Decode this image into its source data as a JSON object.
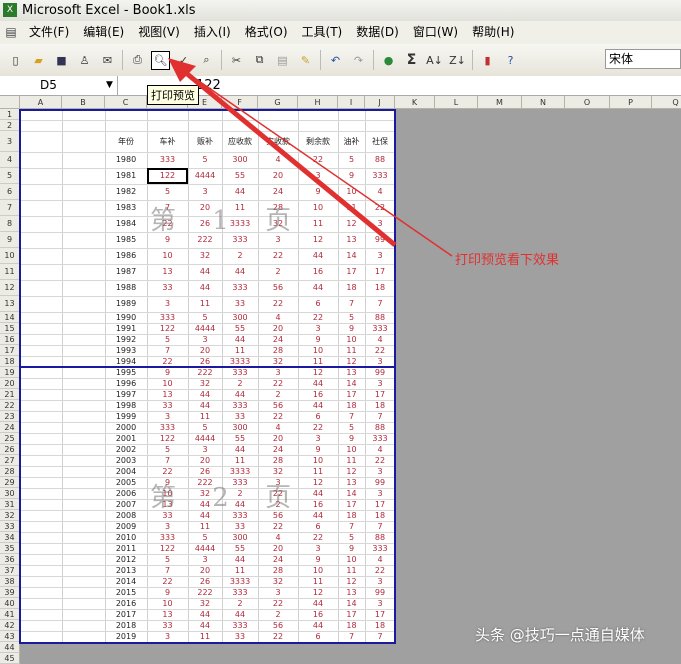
{
  "window": {
    "title": "Microsoft Excel - Book1.xls"
  },
  "menu": [
    "文件(F)",
    "编辑(E)",
    "视图(V)",
    "插入(I)",
    "格式(O)",
    "工具(T)",
    "数据(D)",
    "窗口(W)",
    "帮助(H)"
  ],
  "toolbar": {
    "font": "宋体",
    "tooltip": "打印预览",
    "sigma": "Σ"
  },
  "formula": {
    "cell": "D5",
    "value": "122"
  },
  "columns": [
    "A",
    "B",
    "C",
    "D",
    "E",
    "F",
    "G",
    "H",
    "I",
    "J",
    "K",
    "L",
    "M",
    "N",
    "O",
    "P",
    "Q"
  ],
  "headers": [
    "年份",
    "车补",
    "贩补",
    "应收款",
    "实收款",
    "剩余款",
    "油补",
    "社保"
  ],
  "base_values": [
    [
      "333",
      "5",
      "300",
      "4",
      "22",
      "5",
      "88"
    ],
    [
      "122",
      "4444",
      "55",
      "20",
      "3",
      "9",
      "333"
    ],
    [
      "5",
      "3",
      "44",
      "24",
      "9",
      "10",
      "4"
    ],
    [
      "7",
      "20",
      "11",
      "28",
      "10",
      "11",
      "22"
    ],
    [
      "22",
      "26",
      "3333",
      "32",
      "11",
      "12",
      "3"
    ],
    [
      "9",
      "222",
      "333",
      "3",
      "12",
      "13",
      "99"
    ],
    [
      "10",
      "32",
      "2",
      "22",
      "44",
      "14",
      "3"
    ],
    [
      "13",
      "44",
      "44",
      "2",
      "16",
      "17",
      "17"
    ],
    [
      "33",
      "44",
      "333",
      "56",
      "44",
      "18",
      "18"
    ],
    [
      "3",
      "11",
      "33",
      "22",
      "6",
      "7",
      "7"
    ]
  ],
  "start_year": 1980,
  "row_count": 40,
  "watermarks": [
    "第 1 页",
    "第 2 页"
  ],
  "annotation": "打印预览看下效果",
  "credit": "头条 @技巧一点通自媒体",
  "colors": {
    "page_border": "#1a1aa0",
    "arrow": "#e03030",
    "value_text": "#b02a3a"
  }
}
